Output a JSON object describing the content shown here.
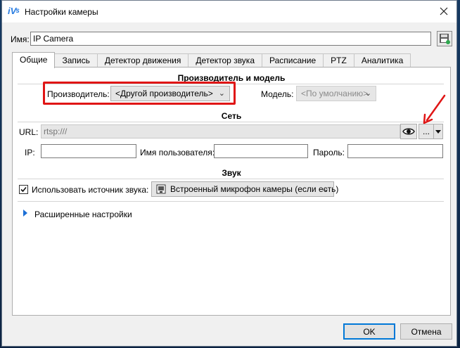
{
  "window": {
    "title": "Настройки камеры"
  },
  "name_field": {
    "label": "Имя:",
    "value": "IP Camera"
  },
  "tabs": [
    {
      "label": "Общие"
    },
    {
      "label": "Запись"
    },
    {
      "label": "Детектор движения"
    },
    {
      "label": "Детектор звука"
    },
    {
      "label": "Расписание"
    },
    {
      "label": "PTZ"
    },
    {
      "label": "Аналитика"
    }
  ],
  "manufacturer_section": {
    "title": "Производитель и модель",
    "manufacturer_label": "Производитель:",
    "manufacturer_value": "<Другой производитель>",
    "model_label": "Модель:",
    "model_value": "<По умолчанию>"
  },
  "network_section": {
    "title": "Сеть",
    "url_label": "URL:",
    "url_placeholder": "rtsp:///",
    "more_button": "...",
    "ip_label": "IP:",
    "ip_value": "",
    "username_label": "Имя пользователя:",
    "username_value": "",
    "password_label": "Пароль:",
    "password_value": ""
  },
  "sound_section": {
    "title": "Звук",
    "use_sound_label": "Использовать источник звука:",
    "use_sound_checked": true,
    "source_value": "Встроенный микрофон камеры (если есть)"
  },
  "advanced": {
    "label": "Расширенные настройки"
  },
  "footer": {
    "ok": "OK",
    "cancel": "Отмена"
  },
  "colors": {
    "highlight": "#e01515",
    "accent": "#0078d7",
    "expander": "#1c6fd6"
  }
}
